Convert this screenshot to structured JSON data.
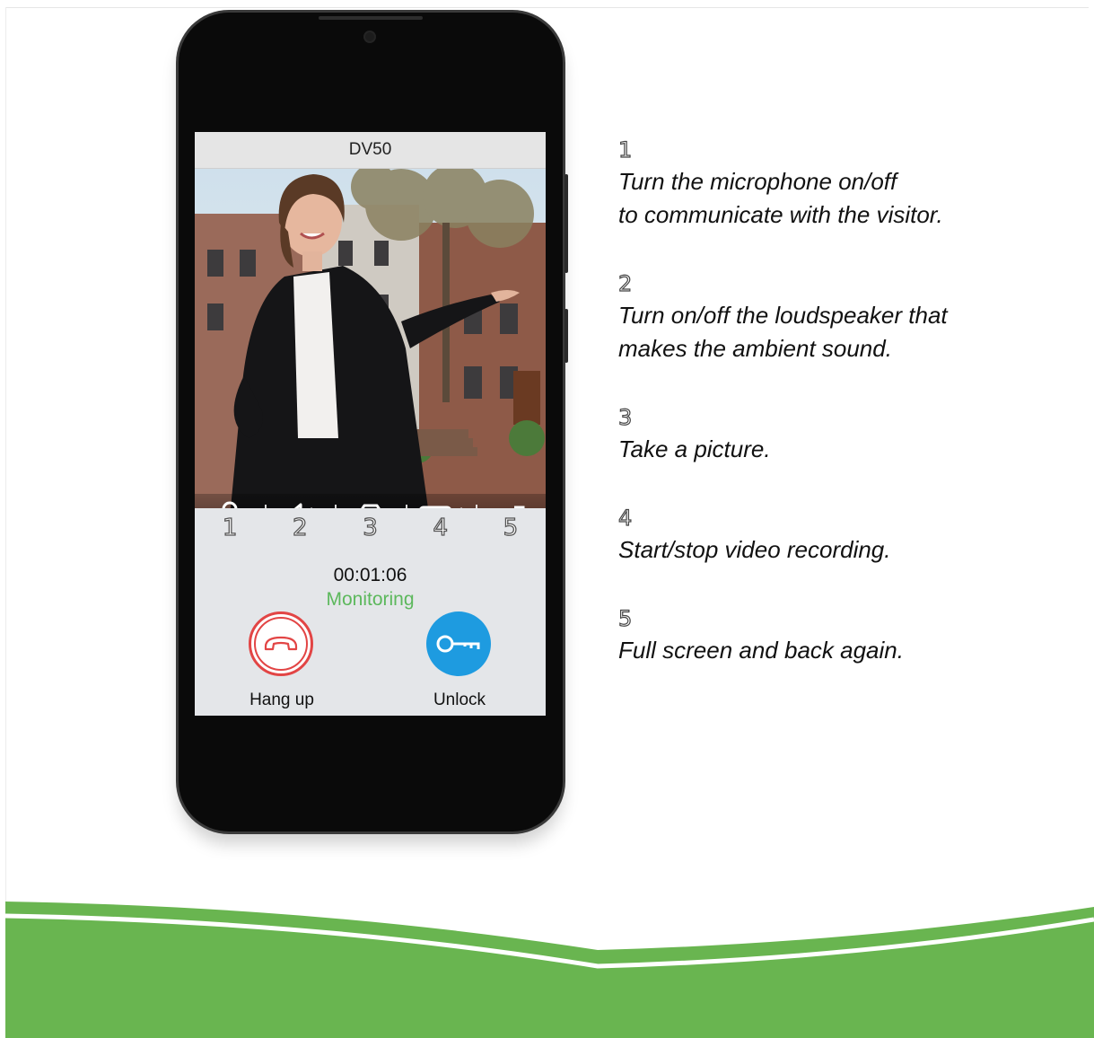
{
  "phone": {
    "title": "DV50",
    "controls": [
      {
        "icon": "microphone-icon",
        "number": "1"
      },
      {
        "icon": "speaker-icon",
        "number": "2"
      },
      {
        "icon": "camera-icon",
        "number": "3"
      },
      {
        "icon": "video-camera-icon",
        "number": "4"
      },
      {
        "icon": "fullscreen-icon",
        "number": "5"
      }
    ],
    "timer": "00:01:06",
    "status": "Monitoring",
    "hangup_label": "Hang up",
    "unlock_label": "Unlock"
  },
  "instructions": [
    {
      "number": "1",
      "text_line1": "Turn the microphone on/off",
      "text_line2": "to communicate with the visitor."
    },
    {
      "number": "2",
      "text_line1": "Turn on/off the loudspeaker that",
      "text_line2": "makes the ambient sound."
    },
    {
      "number": "3",
      "text_line1": "Take a picture.",
      "text_line2": ""
    },
    {
      "number": "4",
      "text_line1": "Start/stop video recording.",
      "text_line2": ""
    },
    {
      "number": "5",
      "text_line1": "Full screen and back again.",
      "text_line2": ""
    }
  ],
  "colors": {
    "status_green": "#5cb85c",
    "hangup_red": "#e24545",
    "unlock_blue": "#1e9be0",
    "wave_green": "#69b550"
  }
}
